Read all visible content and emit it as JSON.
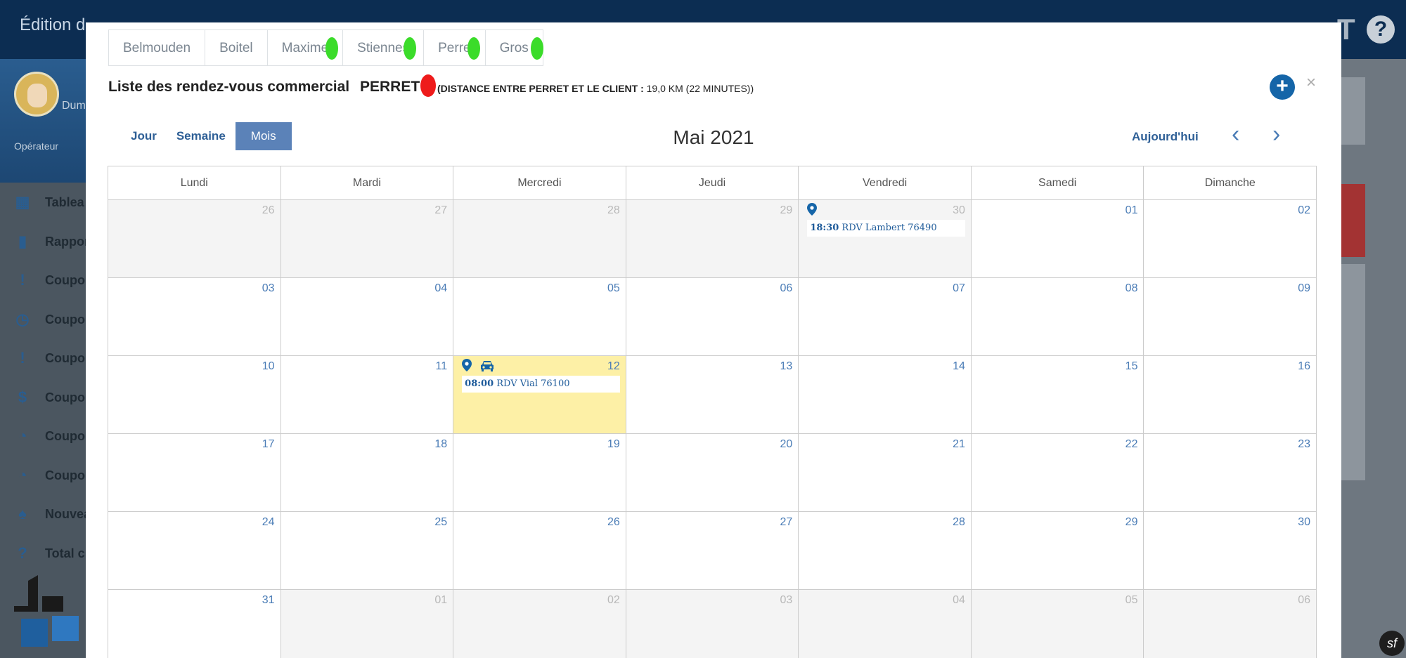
{
  "background": {
    "title": "Édition d",
    "right_letter": "T",
    "help_icon": "?",
    "user_name": "Dum",
    "user_role": "Opérateur",
    "menu": [
      {
        "icon": "dashboard-icon",
        "label": "Tablea"
      },
      {
        "icon": "bar-chart-icon",
        "label": "Rappor"
      },
      {
        "icon": "alert-icon",
        "label": "Coupon"
      },
      {
        "icon": "alarm-clock-icon",
        "label": "Coupon"
      },
      {
        "icon": "alert-icon",
        "label": "Coupon"
      },
      {
        "icon": "dollar-icon",
        "label": "Coupon"
      },
      {
        "icon": "clock-icon",
        "label": "Coupon"
      },
      {
        "icon": "clock-icon",
        "label": "Coupon"
      },
      {
        "icon": "bell-icon",
        "label": "Nouvea"
      },
      {
        "icon": "question-icon",
        "label": "Total c"
      }
    ],
    "symfony_badge": "sf"
  },
  "modal": {
    "tabs": [
      {
        "label": "Belmouden",
        "dot": false
      },
      {
        "label": "Boitel",
        "dot": false
      },
      {
        "label": "Maxime",
        "dot": true
      },
      {
        "label": "Stiennes",
        "dot": true
      },
      {
        "label": "Perre",
        "dot": true
      },
      {
        "label": "Gros",
        "dot": true
      }
    ],
    "list_title": "Liste des rendez-vous commercial",
    "rep_name": "PERRET",
    "distance_label": "(DISTANCE ENTRE  PERRET ET LE CLIENT :",
    "distance_value": " 19,0 KM (22 MINUTES))",
    "add_icon": "+",
    "close_icon": "×",
    "views": {
      "day": "Jour",
      "week": "Semaine",
      "month": "Mois"
    },
    "month_title": "Mai 2021",
    "today": "Aujourd'hui",
    "prev_icon": "‹",
    "next_icon": "›",
    "colors": {
      "primary": "#1565a8",
      "tab_dot": "#3bdc2a",
      "rep_dot": "#ee1b1b",
      "today_bg": "#fdf0a6"
    }
  },
  "calendar": {
    "daynames": [
      "Lundi",
      "Mardi",
      "Mercredi",
      "Jeudi",
      "Vendredi",
      "Samedi",
      "Dimanche"
    ],
    "weeks": [
      [
        {
          "num": "26",
          "other": true
        },
        {
          "num": "27",
          "other": true
        },
        {
          "num": "28",
          "other": true
        },
        {
          "num": "29",
          "other": true
        },
        {
          "num": "30",
          "other": true,
          "pin": true,
          "event": {
            "time": "18:30",
            "text": " RDV Lambert 76490"
          }
        },
        {
          "num": "01"
        },
        {
          "num": "02"
        }
      ],
      [
        {
          "num": "03"
        },
        {
          "num": "04"
        },
        {
          "num": "05"
        },
        {
          "num": "06"
        },
        {
          "num": "07"
        },
        {
          "num": "08"
        },
        {
          "num": "09"
        }
      ],
      [
        {
          "num": "10"
        },
        {
          "num": "11"
        },
        {
          "num": "12",
          "today": true,
          "pin": true,
          "car": true,
          "event": {
            "time": "08:00",
            "text": " RDV Vial 76100"
          }
        },
        {
          "num": "13"
        },
        {
          "num": "14"
        },
        {
          "num": "15"
        },
        {
          "num": "16"
        }
      ],
      [
        {
          "num": "17"
        },
        {
          "num": "18"
        },
        {
          "num": "19"
        },
        {
          "num": "20"
        },
        {
          "num": "21"
        },
        {
          "num": "22"
        },
        {
          "num": "23"
        }
      ],
      [
        {
          "num": "24"
        },
        {
          "num": "25"
        },
        {
          "num": "26"
        },
        {
          "num": "27"
        },
        {
          "num": "28"
        },
        {
          "num": "29"
        },
        {
          "num": "30"
        }
      ],
      [
        {
          "num": "31"
        },
        {
          "num": "01",
          "other": true
        },
        {
          "num": "02",
          "other": true
        },
        {
          "num": "03",
          "other": true
        },
        {
          "num": "04",
          "other": true
        },
        {
          "num": "05",
          "other": true
        },
        {
          "num": "06",
          "other": true
        }
      ]
    ]
  }
}
